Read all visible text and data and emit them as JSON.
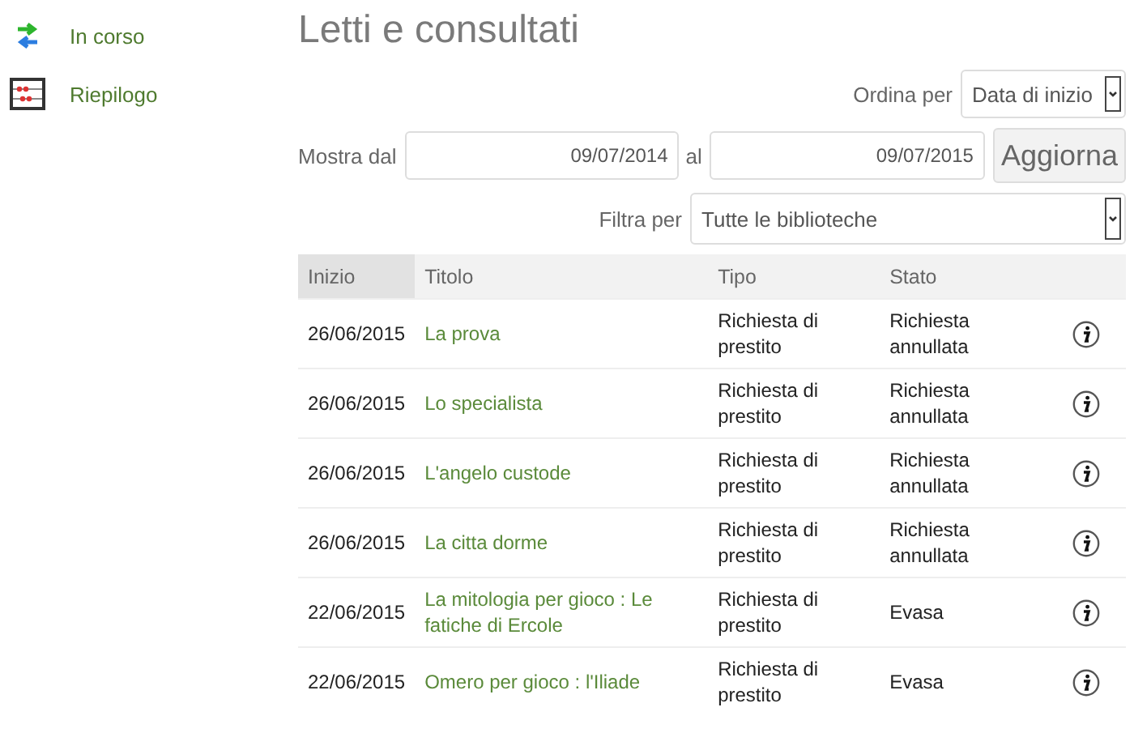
{
  "sidebar": {
    "items": [
      {
        "label": "In corso"
      },
      {
        "label": "Riepilogo"
      }
    ]
  },
  "title": "Letti e consultati",
  "sort": {
    "label": "Ordina per",
    "value": "Data di inizio"
  },
  "range": {
    "from_label": "Mostra dal",
    "from": "09/07/2014",
    "to_label": "al",
    "to": "09/07/2015",
    "button": "Aggiorna"
  },
  "filter": {
    "label": "Filtra per",
    "value": "Tutte le biblioteche"
  },
  "table": {
    "columns": [
      {
        "label": "Inizio",
        "sorted": true
      },
      {
        "label": "Titolo",
        "sorted": false
      },
      {
        "label": "Tipo",
        "sorted": false
      },
      {
        "label": "Stato",
        "sorted": false
      }
    ],
    "rows": [
      {
        "inizio": "26/06/2015",
        "titolo": "La prova",
        "tipo": "Richiesta di prestito",
        "stato": "Richiesta annullata"
      },
      {
        "inizio": "26/06/2015",
        "titolo": "Lo specialista",
        "tipo": "Richiesta di prestito",
        "stato": "Richiesta annullata"
      },
      {
        "inizio": "26/06/2015",
        "titolo": "L'angelo custode",
        "tipo": "Richiesta di prestito",
        "stato": "Richiesta annullata"
      },
      {
        "inizio": "26/06/2015",
        "titolo": "La citta dorme",
        "tipo": "Richiesta di prestito",
        "stato": "Richiesta annullata"
      },
      {
        "inizio": "22/06/2015",
        "titolo": "La mitologia per gioco : Le fatiche di Ercole",
        "tipo": "Richiesta di prestito",
        "stato": "Evasa"
      },
      {
        "inizio": "22/06/2015",
        "titolo": "Omero per gioco : l'Iliade",
        "tipo": "Richiesta di prestito",
        "stato": "Evasa"
      }
    ]
  }
}
